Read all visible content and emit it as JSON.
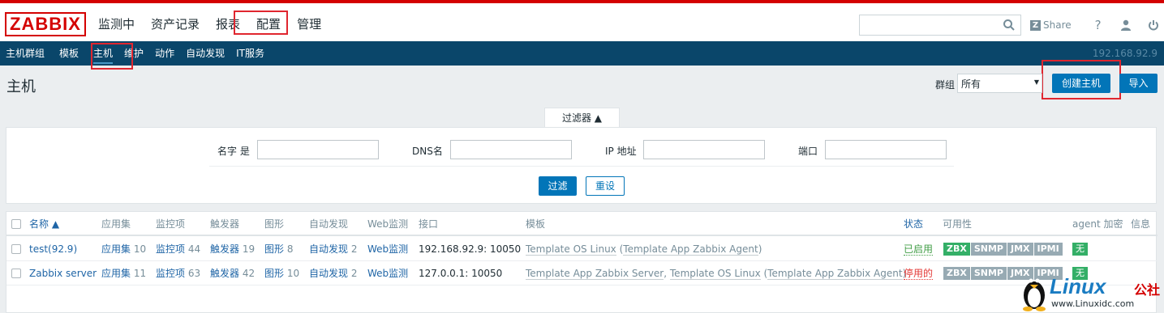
{
  "logo": "ZABBIX",
  "main_menu": [
    "监测中",
    "资产记录",
    "报表",
    "配置",
    "管理"
  ],
  "search": {
    "placeholder": ""
  },
  "toolbar": {
    "share_label": "Share",
    "help": "?",
    "icons": [
      "search-icon",
      "share-icon",
      "help-icon",
      "user-icon",
      "power-icon"
    ]
  },
  "sub_menu": [
    "主机群组",
    "模板",
    "主机",
    "维护",
    "动作",
    "自动发现",
    "IT服务"
  ],
  "server_ip": "192.168.92.9",
  "page_title": "主机",
  "group": {
    "label": "群组",
    "selected": "所有"
  },
  "buttons": {
    "create_host": "创建主机",
    "import": "导入"
  },
  "filter": {
    "tab_label": "过滤器 ▲",
    "name_label": "名字 是",
    "dns_label": "DNS名",
    "ip_label": "IP 地址",
    "port_label": "端口",
    "apply": "过滤",
    "reset": "重设"
  },
  "table": {
    "headers": {
      "name": "名称 ▲",
      "apps": "应用集",
      "items": "监控项",
      "triggers": "触发器",
      "graphs": "图形",
      "discovery": "自动发现",
      "web": "Web监测",
      "interface": "接口",
      "templates": "模板",
      "status": "状态",
      "availability": "可用性",
      "agent_enc": "agent 加密",
      "info": "信息"
    },
    "rows": [
      {
        "name": "test(92.9)",
        "apps": "应用集",
        "apps_n": "10",
        "items": "监控项",
        "items_n": "44",
        "triggers": "触发器",
        "triggers_n": "19",
        "graphs": "图形",
        "graphs_n": "8",
        "discovery": "自动发现",
        "discovery_n": "2",
        "web": "Web监测",
        "interface": "192.168.92.9: 10050",
        "tpl_main": "Template OS Linux",
        "tpl_paren_open": " (",
        "tpl_sub": "Template App Zabbix Agent",
        "tpl_paren_close": ")",
        "status": "已启用",
        "zbx": "ZBX",
        "snmp": "SNMP",
        "jmx": "JMX",
        "ipmi": "IPMI",
        "enc": "无"
      },
      {
        "name": "Zabbix server",
        "apps": "应用集",
        "apps_n": "11",
        "items": "监控项",
        "items_n": "63",
        "triggers": "触发器",
        "triggers_n": "42",
        "graphs": "图形",
        "graphs_n": "10",
        "discovery": "自动发现",
        "discovery_n": "2",
        "web": "Web监测",
        "interface": "127.0.0.1: 10050",
        "tpl_main": "Template App Zabbix Server",
        "tpl_sep": ", ",
        "tpl_main2": "Template OS Linux",
        "tpl_paren_open": " (",
        "tpl_sub": "Template App Zabbix Agent",
        "tpl_paren_close": ")",
        "status": "停用的",
        "zbx": "ZBX",
        "snmp": "SNMP",
        "jmx": "JMX",
        "ipmi": "IPMI",
        "enc": "无"
      }
    ]
  },
  "watermark": {
    "brand": "Linux",
    "cn": "公社",
    "url": "www.Linuxidc.com"
  },
  "colors": {
    "brand_red": "#d40000",
    "nav_blue": "#0a466a",
    "button_blue": "#0275b8",
    "ok_green": "#34af67",
    "highlight_red": "#e0262f"
  }
}
